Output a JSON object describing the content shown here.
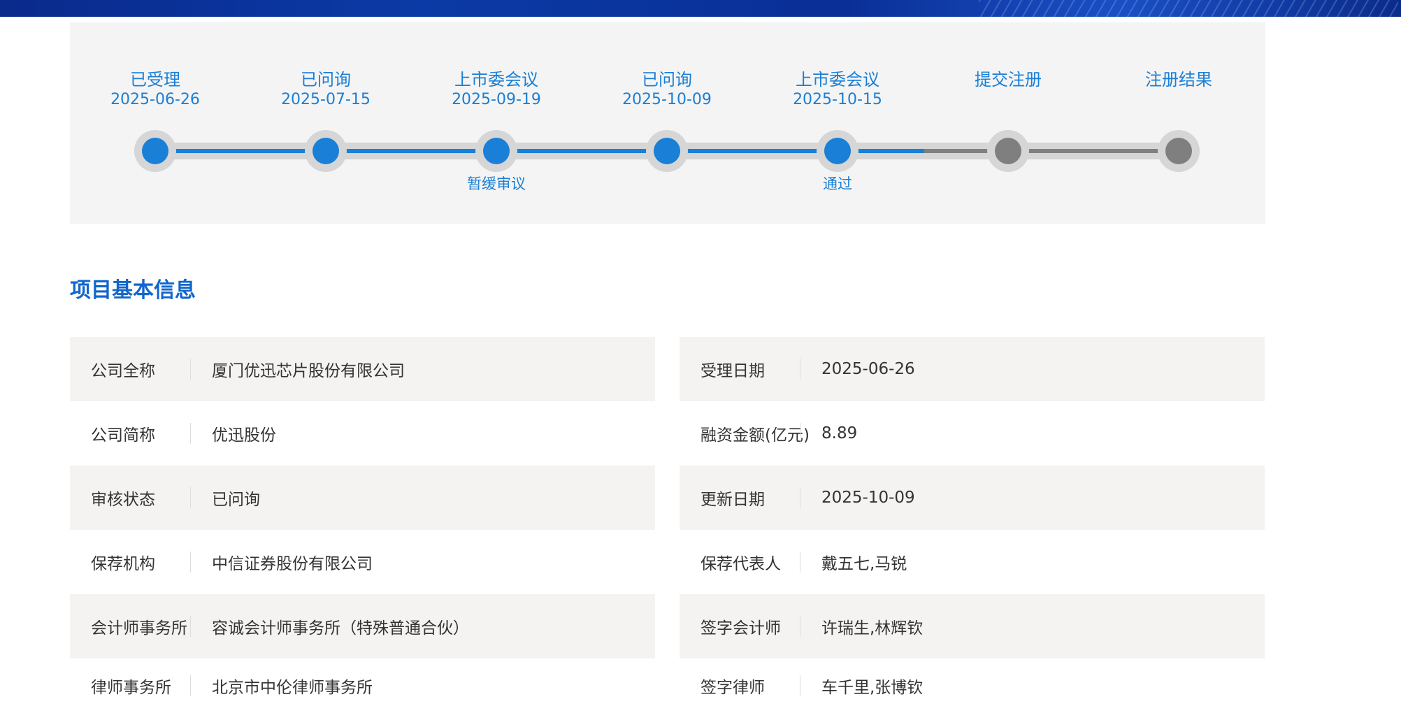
{
  "timeline": {
    "steps": [
      {
        "label": "已受理",
        "date": "2025-06-26",
        "note": "",
        "status": "done"
      },
      {
        "label": "已问询",
        "date": "2025-07-15",
        "note": "",
        "status": "done"
      },
      {
        "label": "上市委会议",
        "date": "2025-09-19",
        "note": "暂缓审议",
        "status": "done"
      },
      {
        "label": "已问询",
        "date": "2025-10-09",
        "note": "",
        "status": "done"
      },
      {
        "label": "上市委会议",
        "date": "2025-10-15",
        "note": "通过",
        "status": "done"
      },
      {
        "label": "提交注册",
        "date": "",
        "note": "",
        "status": "pending"
      },
      {
        "label": "注册结果",
        "date": "",
        "note": "",
        "status": "pending"
      }
    ],
    "colors": {
      "done": "#1a7fd6",
      "pending": "#7f7f7f"
    }
  },
  "section": {
    "title": "项目基本信息"
  },
  "info": {
    "left": [
      {
        "label": "公司全称",
        "value": "厦门优迅芯片股份有限公司"
      },
      {
        "label": "公司简称",
        "value": "优迅股份"
      },
      {
        "label": "审核状态",
        "value": "已问询"
      },
      {
        "label": "保荐机构",
        "value": "中信证券股份有限公司"
      },
      {
        "label": "会计师事务所",
        "value": "容诚会计师事务所（特殊普通合伙）"
      },
      {
        "label": "律师事务所",
        "value": "北京市中伦律师事务所"
      }
    ],
    "right": [
      {
        "label": "受理日期",
        "value": "2025-06-26"
      },
      {
        "label": "融资金额(亿元)",
        "value": "8.89"
      },
      {
        "label": "更新日期",
        "value": "2025-10-09"
      },
      {
        "label": "保荐代表人",
        "value": "戴五七,马锐"
      },
      {
        "label": "签字会计师",
        "value": "许瑞生,林辉钦"
      },
      {
        "label": "签字律师",
        "value": "车千里,张博钦"
      }
    ]
  }
}
